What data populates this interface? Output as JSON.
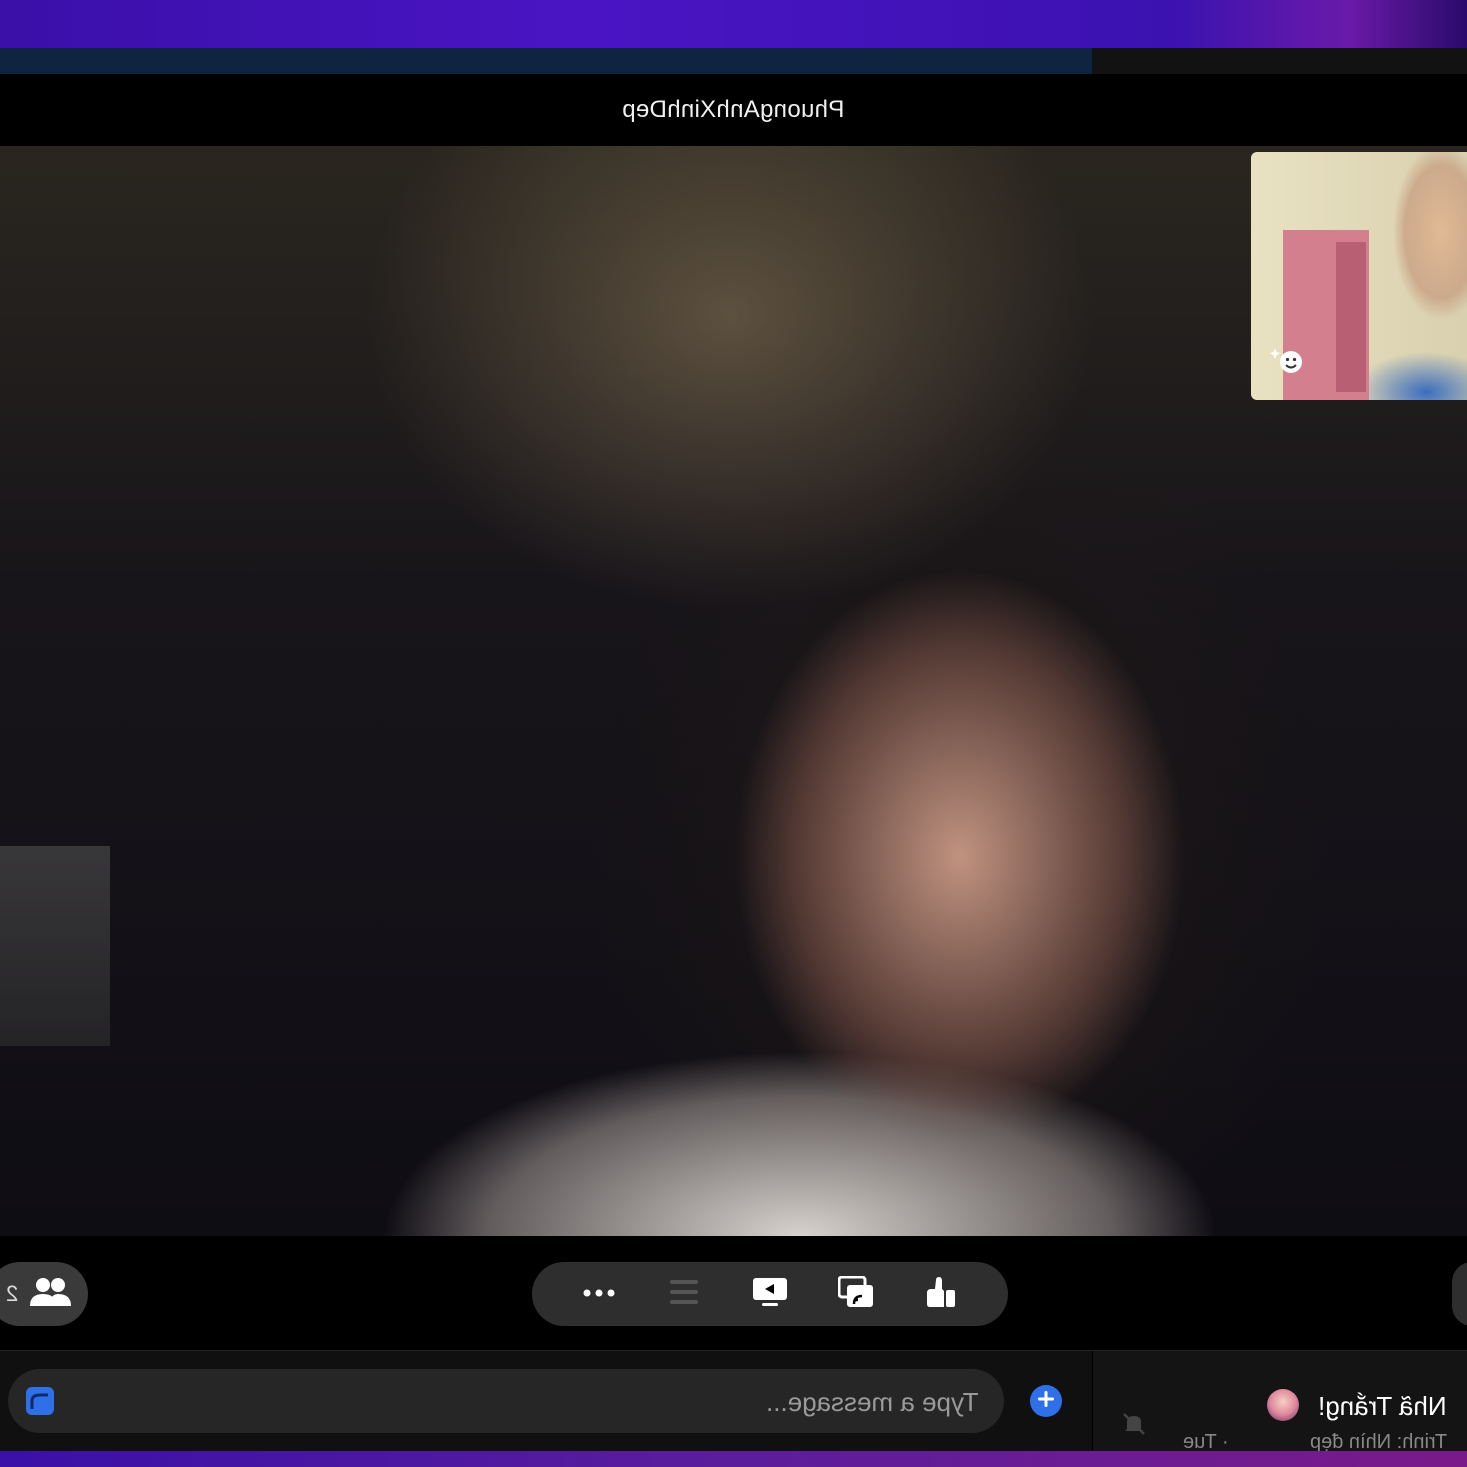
{
  "call": {
    "title": "PhuongAnhXinhDep"
  },
  "participants": {
    "count": "2"
  },
  "toolbar": {
    "more_label": "more",
    "share_label": "share screen",
    "thumbs_label": "like"
  },
  "composer": {
    "placeholder": "Type a message..."
  },
  "chat_item": {
    "name": "Nhã Trắng!",
    "preview": "Trinh: Nhìn đẹp",
    "time": "· Tue"
  },
  "colors": {
    "accent": "#2f6fe8",
    "pill_bg": "#2e2e2e",
    "desktop_gradient": "#3a10a8"
  },
  "icons": {
    "participants": "people-icon",
    "more": "ellipsis-icon",
    "list": "list-icon",
    "share": "screen-share-icon",
    "cast": "cast-icon",
    "like": "thumbs-up-icon",
    "effects": "sparkle-smile-icon",
    "attach": "attach-icon",
    "add": "plus-circle-icon",
    "mute": "bell-mute-icon"
  }
}
